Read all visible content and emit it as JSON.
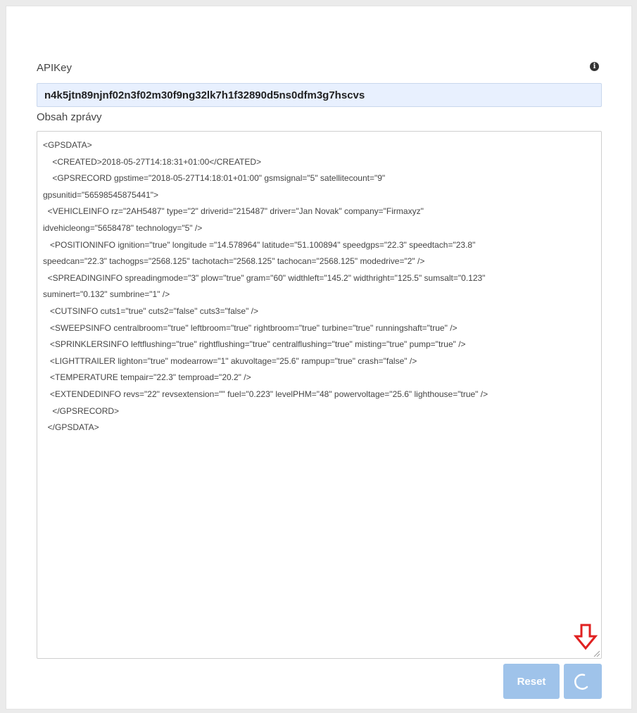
{
  "form": {
    "apikey_label": "APIKey",
    "apikey_value": "n4k5jtn89njnf02n3f02m30f9ng32lk7h1f32890d5ns0dfm3g7hscvs",
    "info_icon": "info-circle-icon",
    "message_label": "Obsah zprávy",
    "message_lines": [
      "<GPSDATA>",
      "    <CREATED>2018-05-27T14:18:31+01:00</CREATED>",
      "    <GPSRECORD gpstime=\"2018-05-27T14:18:01+01:00\" gsmsignal=\"5\" satellitecount=\"9\"",
      "gpsunitid=\"56598545875441\">",
      "  <VEHICLEINFO rz=\"2AH5487\" type=\"2\" driverid=\"215487\" driver=\"Jan Novak\" company=\"Firmaxyz\"",
      "idvehicleong=\"5658478\" technology=\"5\" />",
      "   <POSITIONINFO ignition=\"true\" longitude =\"14.578964\" latitude=\"51.100894\" speedgps=\"22.3\" speedtach=\"23.8\"",
      "speedcan=\"22.3\" tachogps=\"2568.125\" tachotach=\"2568.125\" tachocan=\"2568.125\" modedrive=\"2\" />",
      "  <SPREADINGINFO spreadingmode=\"3\" plow=\"true\" gram=\"60\" widthleft=\"145.2\" widthright=\"125.5\" sumsalt=\"0.123\"",
      "suminert=\"0.132\" sumbrine=\"1\" />",
      "   <CUTSINFO cuts1=\"true\" cuts2=\"false\" cuts3=\"false\" />",
      "   <SWEEPSINFO centralbroom=\"true\" leftbroom=\"true\" rightbroom=\"true\" turbine=\"true\" runningshaft=\"true\" />",
      "   <SPRINKLERSINFO leftflushing=\"true\" rightflushing=\"true\" centralflushing=\"true\" misting=\"true\" pump=\"true\" />",
      "   <LIGHTTRAILER lighton=\"true\" modearrow=\"1\" akuvoltage=\"25.6\" rampup=\"true\" crash=\"false\" />",
      "   <TEMPERATURE tempair=\"22.3\" temproad=\"20.2\" />",
      "   <EXTENDEDINFO revs=\"22\" revsextension=\"\" fuel=\"0.223\" levelPHM=\"48\" powervoltage=\"25.6\" lighthouse=\"true\" />",
      "    </GPSRECORD>",
      "  </GPSDATA>"
    ]
  },
  "actions": {
    "reset_label": "Reset",
    "send_icon": "spinner-icon",
    "arrow_icon": "arrow-down-icon",
    "button_color": "#9fc3ea",
    "arrow_color": "#e02020"
  }
}
